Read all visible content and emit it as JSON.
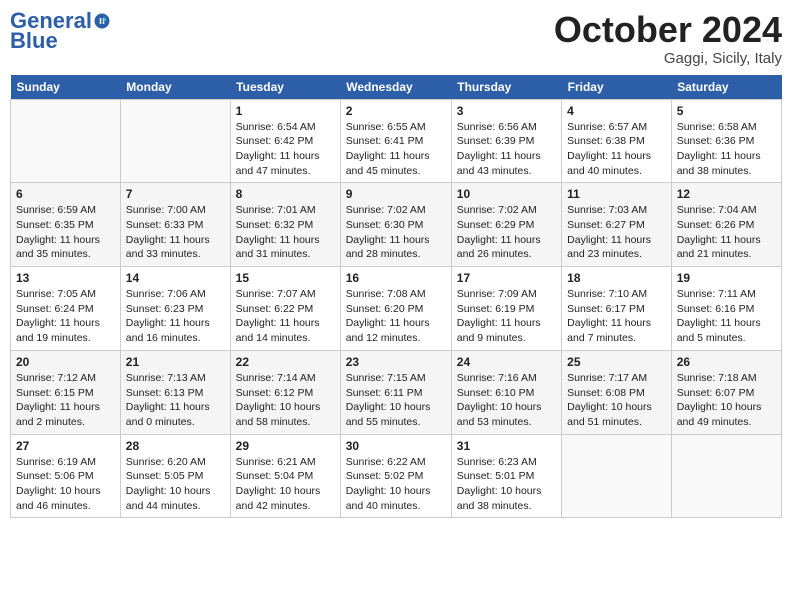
{
  "header": {
    "logo_line1": "General",
    "logo_line2": "Blue",
    "month": "October 2024",
    "location": "Gaggi, Sicily, Italy"
  },
  "weekdays": [
    "Sunday",
    "Monday",
    "Tuesday",
    "Wednesday",
    "Thursday",
    "Friday",
    "Saturday"
  ],
  "weeks": [
    [
      {
        "day": "",
        "info": ""
      },
      {
        "day": "",
        "info": ""
      },
      {
        "day": "1",
        "info": "Sunrise: 6:54 AM\nSunset: 6:42 PM\nDaylight: 11 hours and 47 minutes."
      },
      {
        "day": "2",
        "info": "Sunrise: 6:55 AM\nSunset: 6:41 PM\nDaylight: 11 hours and 45 minutes."
      },
      {
        "day": "3",
        "info": "Sunrise: 6:56 AM\nSunset: 6:39 PM\nDaylight: 11 hours and 43 minutes."
      },
      {
        "day": "4",
        "info": "Sunrise: 6:57 AM\nSunset: 6:38 PM\nDaylight: 11 hours and 40 minutes."
      },
      {
        "day": "5",
        "info": "Sunrise: 6:58 AM\nSunset: 6:36 PM\nDaylight: 11 hours and 38 minutes."
      }
    ],
    [
      {
        "day": "6",
        "info": "Sunrise: 6:59 AM\nSunset: 6:35 PM\nDaylight: 11 hours and 35 minutes."
      },
      {
        "day": "7",
        "info": "Sunrise: 7:00 AM\nSunset: 6:33 PM\nDaylight: 11 hours and 33 minutes."
      },
      {
        "day": "8",
        "info": "Sunrise: 7:01 AM\nSunset: 6:32 PM\nDaylight: 11 hours and 31 minutes."
      },
      {
        "day": "9",
        "info": "Sunrise: 7:02 AM\nSunset: 6:30 PM\nDaylight: 11 hours and 28 minutes."
      },
      {
        "day": "10",
        "info": "Sunrise: 7:02 AM\nSunset: 6:29 PM\nDaylight: 11 hours and 26 minutes."
      },
      {
        "day": "11",
        "info": "Sunrise: 7:03 AM\nSunset: 6:27 PM\nDaylight: 11 hours and 23 minutes."
      },
      {
        "day": "12",
        "info": "Sunrise: 7:04 AM\nSunset: 6:26 PM\nDaylight: 11 hours and 21 minutes."
      }
    ],
    [
      {
        "day": "13",
        "info": "Sunrise: 7:05 AM\nSunset: 6:24 PM\nDaylight: 11 hours and 19 minutes."
      },
      {
        "day": "14",
        "info": "Sunrise: 7:06 AM\nSunset: 6:23 PM\nDaylight: 11 hours and 16 minutes."
      },
      {
        "day": "15",
        "info": "Sunrise: 7:07 AM\nSunset: 6:22 PM\nDaylight: 11 hours and 14 minutes."
      },
      {
        "day": "16",
        "info": "Sunrise: 7:08 AM\nSunset: 6:20 PM\nDaylight: 11 hours and 12 minutes."
      },
      {
        "day": "17",
        "info": "Sunrise: 7:09 AM\nSunset: 6:19 PM\nDaylight: 11 hours and 9 minutes."
      },
      {
        "day": "18",
        "info": "Sunrise: 7:10 AM\nSunset: 6:17 PM\nDaylight: 11 hours and 7 minutes."
      },
      {
        "day": "19",
        "info": "Sunrise: 7:11 AM\nSunset: 6:16 PM\nDaylight: 11 hours and 5 minutes."
      }
    ],
    [
      {
        "day": "20",
        "info": "Sunrise: 7:12 AM\nSunset: 6:15 PM\nDaylight: 11 hours and 2 minutes."
      },
      {
        "day": "21",
        "info": "Sunrise: 7:13 AM\nSunset: 6:13 PM\nDaylight: 11 hours and 0 minutes."
      },
      {
        "day": "22",
        "info": "Sunrise: 7:14 AM\nSunset: 6:12 PM\nDaylight: 10 hours and 58 minutes."
      },
      {
        "day": "23",
        "info": "Sunrise: 7:15 AM\nSunset: 6:11 PM\nDaylight: 10 hours and 55 minutes."
      },
      {
        "day": "24",
        "info": "Sunrise: 7:16 AM\nSunset: 6:10 PM\nDaylight: 10 hours and 53 minutes."
      },
      {
        "day": "25",
        "info": "Sunrise: 7:17 AM\nSunset: 6:08 PM\nDaylight: 10 hours and 51 minutes."
      },
      {
        "day": "26",
        "info": "Sunrise: 7:18 AM\nSunset: 6:07 PM\nDaylight: 10 hours and 49 minutes."
      }
    ],
    [
      {
        "day": "27",
        "info": "Sunrise: 6:19 AM\nSunset: 5:06 PM\nDaylight: 10 hours and 46 minutes."
      },
      {
        "day": "28",
        "info": "Sunrise: 6:20 AM\nSunset: 5:05 PM\nDaylight: 10 hours and 44 minutes."
      },
      {
        "day": "29",
        "info": "Sunrise: 6:21 AM\nSunset: 5:04 PM\nDaylight: 10 hours and 42 minutes."
      },
      {
        "day": "30",
        "info": "Sunrise: 6:22 AM\nSunset: 5:02 PM\nDaylight: 10 hours and 40 minutes."
      },
      {
        "day": "31",
        "info": "Sunrise: 6:23 AM\nSunset: 5:01 PM\nDaylight: 10 hours and 38 minutes."
      },
      {
        "day": "",
        "info": ""
      },
      {
        "day": "",
        "info": ""
      }
    ]
  ]
}
